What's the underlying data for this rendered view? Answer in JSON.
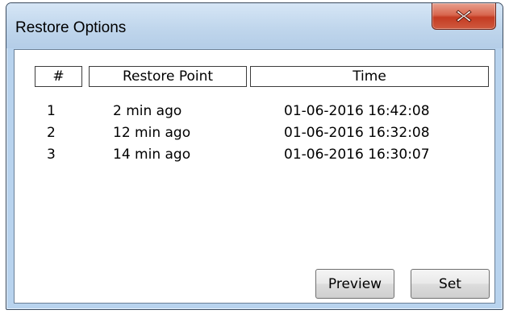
{
  "window": {
    "title": "Restore Options",
    "close_icon": "close-icon"
  },
  "table": {
    "columns": [
      "#",
      "Restore Point",
      "Time"
    ],
    "rows": [
      {
        "num": "1",
        "point": "2 min ago",
        "time": "01-06-2016 16:42:08"
      },
      {
        "num": "2",
        "point": "12 min ago",
        "time": "01-06-2016 16:32:08"
      },
      {
        "num": "3",
        "point": "14 min ago",
        "time": "01-06-2016 16:30:07"
      }
    ]
  },
  "buttons": {
    "preview_label": "Preview",
    "set_label": "Set"
  },
  "colors": {
    "frame": "#b8d3ee",
    "close_button": "#c43b22",
    "client_background": "#ffffff"
  }
}
